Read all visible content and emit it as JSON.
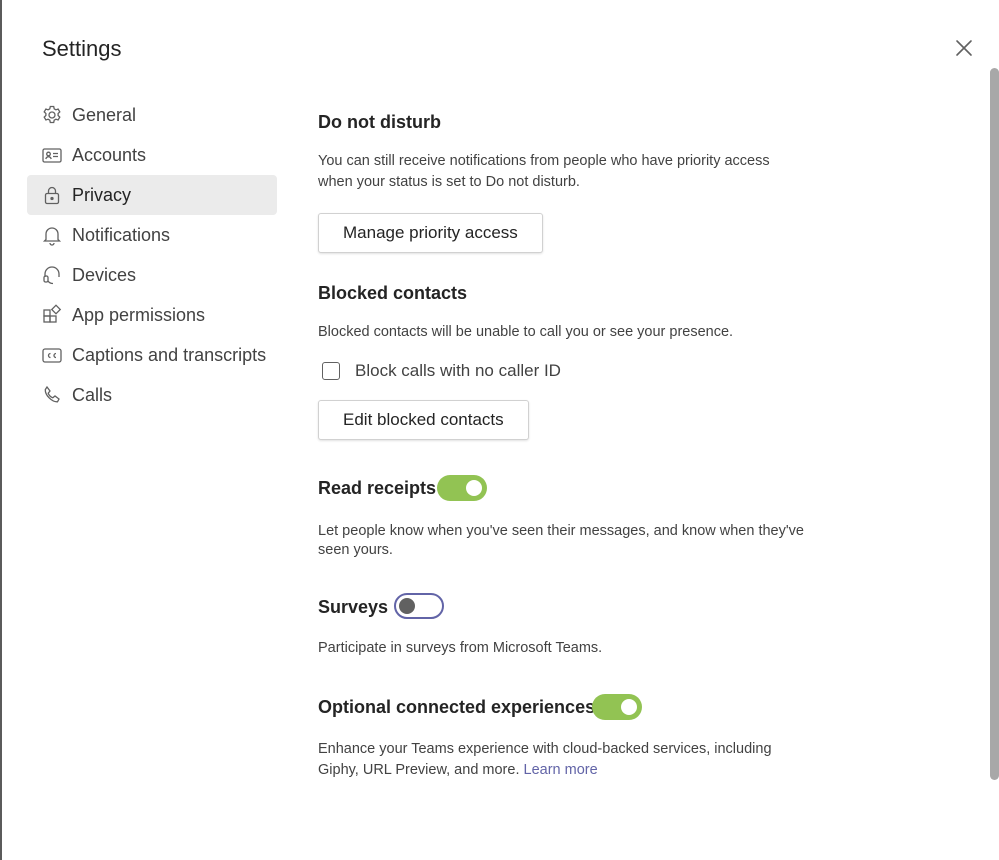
{
  "dialog": {
    "title": "Settings"
  },
  "sidebar": {
    "items": [
      {
        "label": "General",
        "icon": "gear-icon"
      },
      {
        "label": "Accounts",
        "icon": "id-card-icon"
      },
      {
        "label": "Privacy",
        "icon": "lock-icon",
        "selected": true
      },
      {
        "label": "Notifications",
        "icon": "bell-icon"
      },
      {
        "label": "Devices",
        "icon": "headset-icon"
      },
      {
        "label": "App permissions",
        "icon": "apps-icon"
      },
      {
        "label": "Captions and transcripts",
        "icon": "closed-captions-icon"
      },
      {
        "label": "Calls",
        "icon": "phone-icon"
      }
    ]
  },
  "privacy": {
    "dnd": {
      "heading": "Do not disturb",
      "description": "You can still receive notifications from people who have priority access when your status is set to Do not disturb.",
      "button_label": "Manage priority access"
    },
    "blocked": {
      "heading": "Blocked contacts",
      "description": "Blocked contacts will be unable to call you or see your presence.",
      "checkbox_label": "Block calls with no caller ID",
      "checkbox_checked": false,
      "button_label": "Edit blocked contacts"
    },
    "read_receipts": {
      "heading": "Read receipts",
      "enabled": true,
      "description": "Let people know when you've seen their messages, and know when they've seen yours."
    },
    "surveys": {
      "heading": "Surveys",
      "enabled": false,
      "description": "Participate in surveys from Microsoft Teams."
    },
    "optional_experiences": {
      "heading": "Optional connected experiences",
      "enabled": true,
      "description": "Enhance your Teams experience with cloud-backed services, including Giphy, URL Preview, and more.",
      "link_text": "Learn more"
    }
  },
  "colors": {
    "toggle_on": "#92c353",
    "toggle_off_border": "#6264a7",
    "link": "#6264a7",
    "selected_nav_bg": "#ebebeb"
  }
}
